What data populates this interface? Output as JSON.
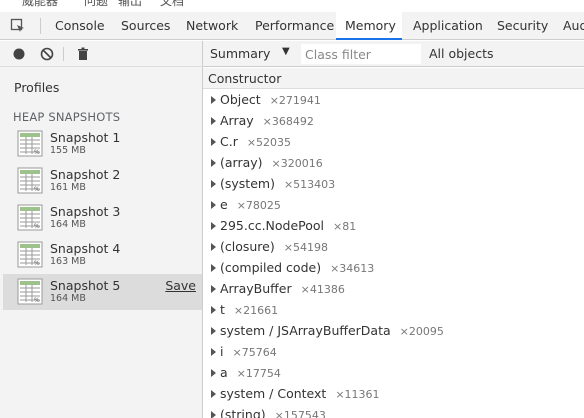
{
  "top_strip": {
    "texts": [
      "威能器",
      "问题",
      "输出",
      "文档"
    ]
  },
  "tabs": [
    "Console",
    "Sources",
    "Network",
    "Performance",
    "Memory",
    "Application",
    "Security",
    "Aud"
  ],
  "active_tab": "Memory",
  "left_panel": {
    "profiles_title": "Profiles",
    "heap_title": "HEAP SNAPSHOTS",
    "snapshots": [
      {
        "name": "Snapshot 1",
        "size": "155 MB"
      },
      {
        "name": "Snapshot 2",
        "size": "161 MB"
      },
      {
        "name": "Snapshot 3",
        "size": "164 MB"
      },
      {
        "name": "Snapshot 4",
        "size": "163 MB"
      },
      {
        "name": "Snapshot 5",
        "size": "164 MB",
        "save_label": "Save",
        "selected": true
      }
    ]
  },
  "right_panel": {
    "view_select": "Summary",
    "class_filter_placeholder": "Class filter",
    "scope": "All objects",
    "column_header": "Constructor",
    "rows": [
      {
        "name": "Object",
        "count": "×271941"
      },
      {
        "name": "Array",
        "count": "×368492"
      },
      {
        "name": "C.r",
        "count": "×52035"
      },
      {
        "name": "(array)",
        "count": "×320016"
      },
      {
        "name": "(system)",
        "count": "×513403"
      },
      {
        "name": "e",
        "count": "×78025"
      },
      {
        "name": "295.cc.NodePool",
        "count": "×81"
      },
      {
        "name": "(closure)",
        "count": "×54198"
      },
      {
        "name": "(compiled code)",
        "count": "×34613"
      },
      {
        "name": "ArrayBuffer",
        "count": "×41386"
      },
      {
        "name": "t",
        "count": "×21661"
      },
      {
        "name": "system / JSArrayBufferData",
        "count": "×20095"
      },
      {
        "name": "i",
        "count": "×75764"
      },
      {
        "name": "a",
        "count": "×17754"
      },
      {
        "name": "system / Context",
        "count": "×11361"
      },
      {
        "name": "(string)",
        "count": "×157543"
      }
    ]
  },
  "colors": {
    "accent": "#1a73e8",
    "panel_bg": "#f3f3f3",
    "selected_bg": "#dcdcdc"
  }
}
